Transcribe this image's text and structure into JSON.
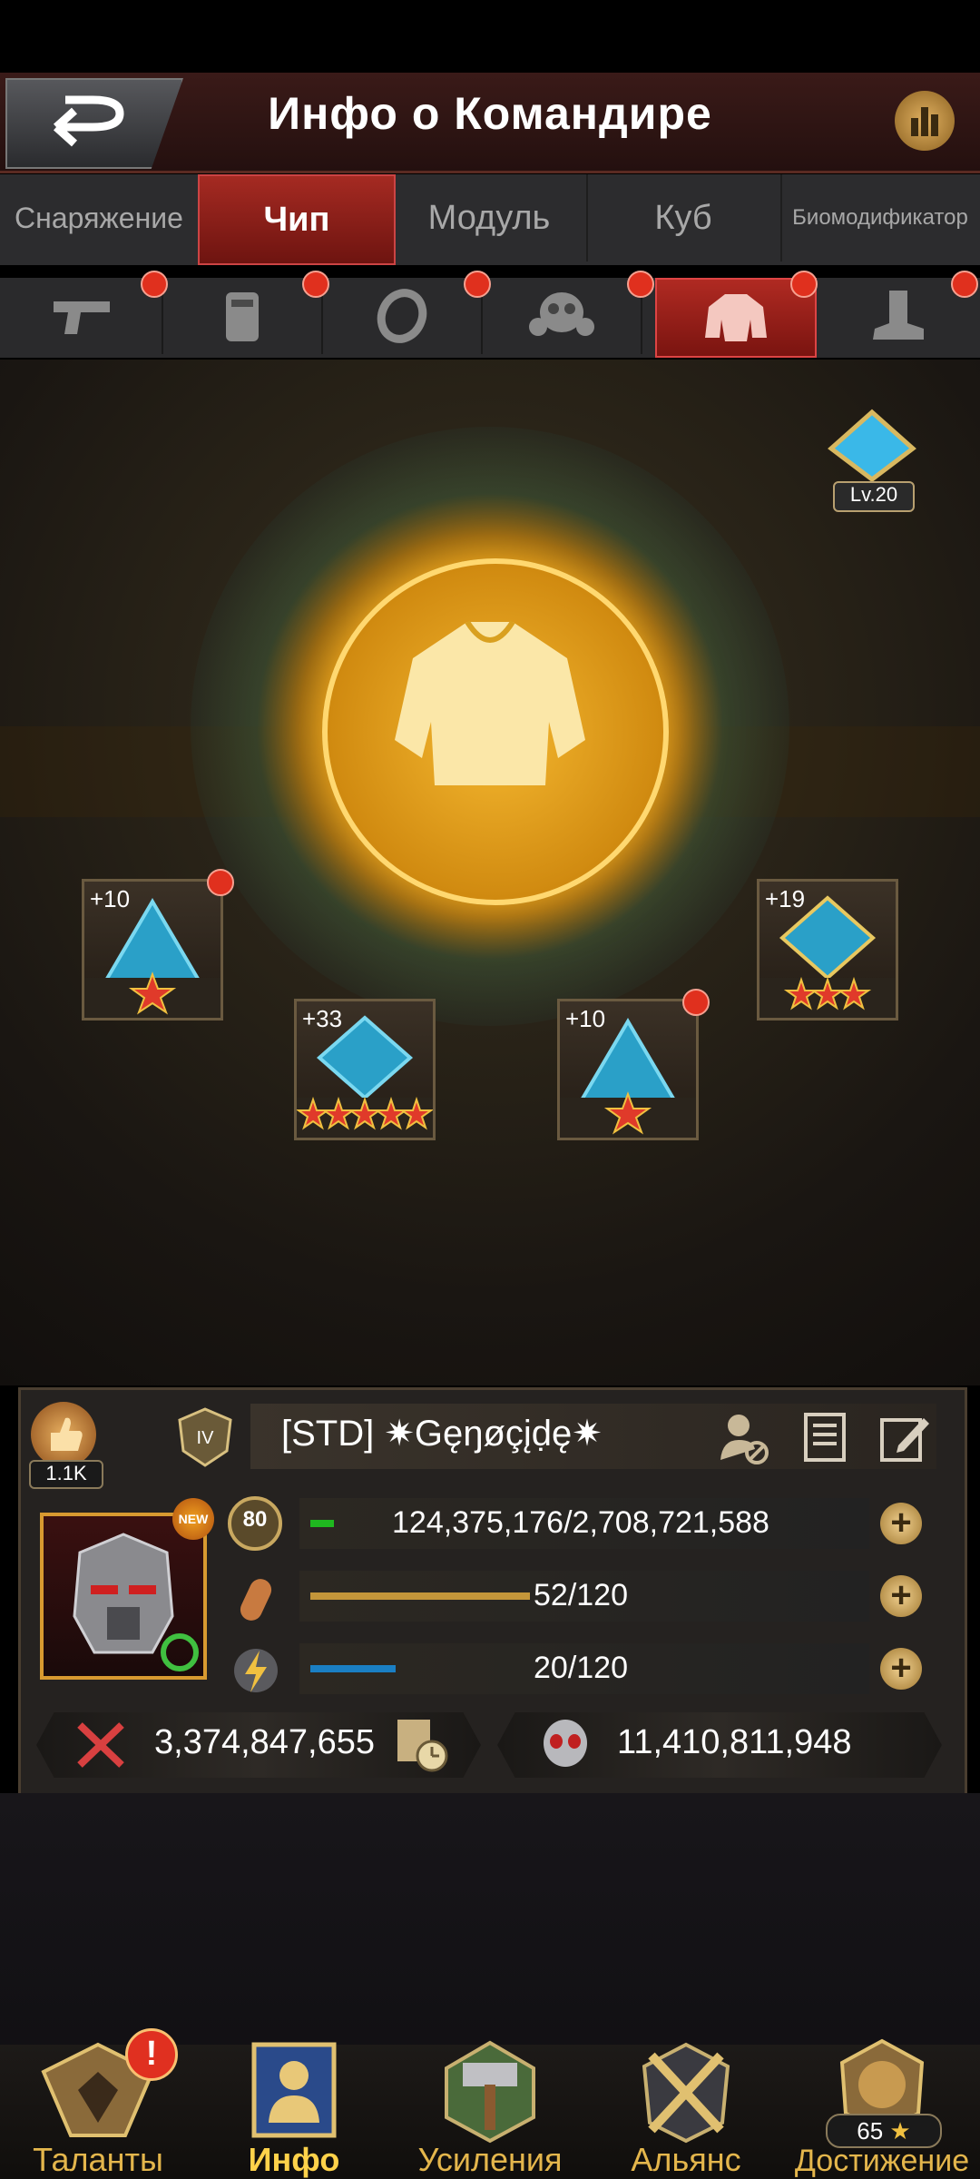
{
  "header": {
    "title": "Инфо о Командире"
  },
  "tabs": [
    {
      "label": "Снаряжение"
    },
    {
      "label": "Чип"
    },
    {
      "label": "Модуль"
    },
    {
      "label": "Куб"
    },
    {
      "label": "Биомодификатор"
    }
  ],
  "active_tab": "Чип",
  "slots": [
    "pistol-icon",
    "armor-vest-icon",
    "ring-icon",
    "gas-mask-icon",
    "jacket-icon",
    "boot-icon"
  ],
  "level_badge": "Lv.20",
  "chips": [
    {
      "plus": "+10",
      "stars": 1
    },
    {
      "plus": "+33",
      "stars": 5
    },
    {
      "plus": "+10",
      "stars": 1
    },
    {
      "plus": "+19",
      "stars": 3
    }
  ],
  "profile": {
    "likes": "1.1K",
    "name": "[STD]  ✷Gęŋøçįḍę✷",
    "level": "80",
    "avatar_badge": "NEW",
    "exp": {
      "label": "124,375,176/2,708,721,588",
      "fraction": 0.046
    },
    "stamina": {
      "label": "52/120",
      "fraction": 0.433
    },
    "energy": {
      "label": "20/120",
      "fraction": 0.167
    },
    "power": "3,374,847,655",
    "kills": "11,410,811,948"
  },
  "nav": [
    {
      "label": "Таланты"
    },
    {
      "label": "Инфо"
    },
    {
      "label": "Усиления"
    },
    {
      "label": "Альянс"
    },
    {
      "label": "Достижение",
      "count": "65"
    }
  ],
  "colors": {
    "accent_red": "#b02a22",
    "gold": "#e4b64c",
    "exp_green": "#1fb81f",
    "stamina_orange": "#c4963a",
    "energy_blue": "#1a7fc4"
  }
}
